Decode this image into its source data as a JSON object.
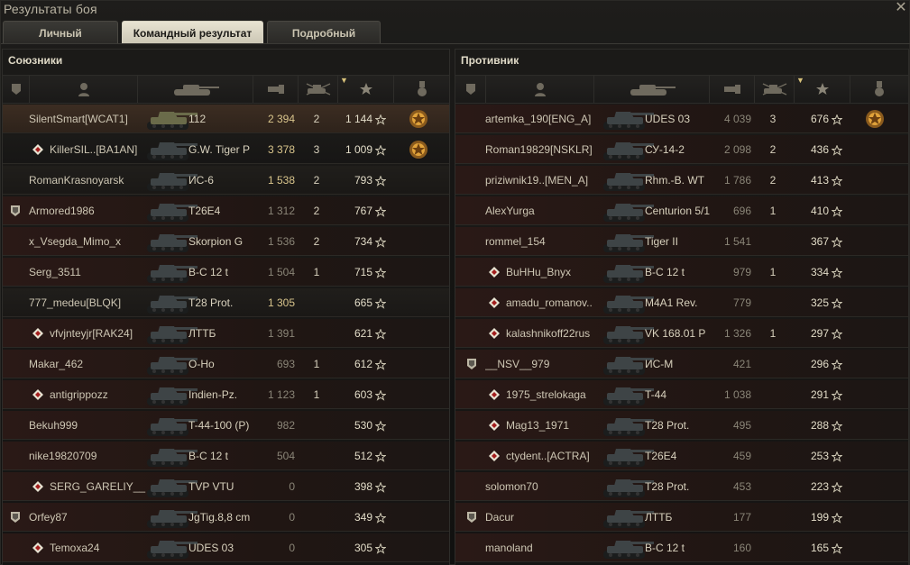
{
  "window": {
    "title": "Результаты боя",
    "close": "✕"
  },
  "tabs": [
    {
      "label": "Личный результат",
      "active": false
    },
    {
      "label": "Командный результат",
      "active": true
    },
    {
      "label": "Подробный отчёт",
      "active": false
    }
  ],
  "allies": {
    "title": "Союзники",
    "rows": [
      {
        "name": "SilentSmart[WCAT1]",
        "vehicle": "112",
        "damage": "2 394",
        "dmg_hi": true,
        "kills": "2",
        "xp": "1 144",
        "medal": true,
        "self": true,
        "badge": ""
      },
      {
        "name": "KillerSIL..[BA1AN]",
        "vehicle": "G.W. Tiger P",
        "damage": "3 378",
        "dmg_hi": true,
        "kills": "3",
        "xp": "1 009",
        "medal": true,
        "badge": "diamond"
      },
      {
        "name": "RomanKrasnoyarsk",
        "vehicle": "ИС-6",
        "damage": "1 538",
        "dmg_hi": true,
        "kills": "2",
        "xp": "793",
        "badge": ""
      },
      {
        "name": "Armored1986",
        "vehicle": "T26E4",
        "damage": "1 312",
        "dmg_hi": false,
        "kills": "2",
        "xp": "767",
        "badge": "platoon",
        "red": true
      },
      {
        "name": "x_Vsegda_Mimo_x",
        "vehicle": "Skorpion G",
        "damage": "1 536",
        "dmg_hi": false,
        "kills": "2",
        "xp": "734",
        "badge": "",
        "red": true
      },
      {
        "name": "Serg_3511",
        "vehicle": "В-С 12 t",
        "damage": "1 504",
        "dmg_hi": false,
        "kills": "1",
        "xp": "715",
        "badge": "",
        "red": true
      },
      {
        "name": "777_medeu[BLQK]",
        "vehicle": "T28 Prot.",
        "damage": "1 305",
        "dmg_hi": true,
        "kills": "",
        "xp": "665",
        "badge": ""
      },
      {
        "name": "vfvjnteyjr[RAK24]",
        "vehicle": "ЛТТБ",
        "damage": "1 391",
        "dmg_hi": false,
        "kills": "",
        "xp": "621",
        "badge": "diamond",
        "red": true
      },
      {
        "name": "Makar_462",
        "vehicle": "O-Ho",
        "damage": "693",
        "dmg_hi": false,
        "kills": "1",
        "xp": "612",
        "badge": "",
        "red": true
      },
      {
        "name": "antigrippozz",
        "vehicle": "Indien-Pz.",
        "damage": "1 123",
        "dmg_hi": false,
        "kills": "1",
        "xp": "603",
        "badge": "diamond",
        "red": true
      },
      {
        "name": "Bekuh999",
        "vehicle": "T-44-100 (P)",
        "damage": "982",
        "dmg_hi": false,
        "kills": "",
        "xp": "530",
        "badge": "",
        "red": true
      },
      {
        "name": "nike19820709",
        "vehicle": "В-С 12 t",
        "damage": "504",
        "dmg_hi": false,
        "kills": "",
        "xp": "512",
        "badge": "",
        "red": true
      },
      {
        "name": "SERG_GARELIY__",
        "vehicle": "TVP VTU",
        "damage": "0",
        "dmg_hi": false,
        "kills": "",
        "xp": "398",
        "badge": "diamond",
        "red": true
      },
      {
        "name": "Orfey87",
        "vehicle": "JgTig.8,8 cm",
        "damage": "0",
        "dmg_hi": false,
        "kills": "",
        "xp": "349",
        "badge": "platoon",
        "red": true
      },
      {
        "name": "Temoxa24",
        "vehicle": "UDES 03",
        "damage": "0",
        "dmg_hi": false,
        "kills": "",
        "xp": "305",
        "badge": "diamond",
        "red": true
      }
    ]
  },
  "enemies": {
    "title": "Противник",
    "rows": [
      {
        "name": "artemka_190[ENG_A]",
        "vehicle": "UDES 03",
        "damage": "4 039",
        "kills": "3",
        "xp": "676",
        "medal": true,
        "badge": "",
        "red": true
      },
      {
        "name": "Roman19829[NSKLR]",
        "vehicle": "СУ-14-2",
        "damage": "2 098",
        "kills": "2",
        "xp": "436",
        "badge": "",
        "red": true
      },
      {
        "name": "priziwnik19..[MEN_A]",
        "vehicle": "Rhm.-B. WT",
        "damage": "1 786",
        "kills": "2",
        "xp": "413",
        "badge": "",
        "red": true
      },
      {
        "name": "AlexYurga",
        "vehicle": "Centurion 5/1",
        "damage": "696",
        "kills": "1",
        "xp": "410",
        "badge": "",
        "red": true
      },
      {
        "name": "rommel_154",
        "vehicle": "Tiger II",
        "damage": "1 541",
        "kills": "",
        "xp": "367",
        "badge": "",
        "red": true
      },
      {
        "name": "BuHHu_Bnyx",
        "vehicle": "В-С 12 t",
        "damage": "979",
        "kills": "1",
        "xp": "334",
        "badge": "diamond",
        "red": true
      },
      {
        "name": "amadu_romanov..",
        "vehicle": "M4A1 Rev.",
        "damage": "779",
        "kills": "",
        "xp": "325",
        "badge": "diamond",
        "red": true
      },
      {
        "name": "kalashnikoff22rus",
        "vehicle": "VK 168.01 P",
        "damage": "1 326",
        "kills": "1",
        "xp": "297",
        "badge": "diamond",
        "red": true
      },
      {
        "name": "__NSV__979",
        "vehicle": "ИС-М",
        "damage": "421",
        "kills": "",
        "xp": "296",
        "badge": "platoon",
        "red": true
      },
      {
        "name": "1975_strelokaga",
        "vehicle": "T-44",
        "damage": "1 038",
        "kills": "",
        "xp": "291",
        "badge": "diamond",
        "red": true
      },
      {
        "name": "Mag13_1971",
        "vehicle": "T28 Prot.",
        "damage": "495",
        "kills": "",
        "xp": "288",
        "badge": "diamond",
        "red": true
      },
      {
        "name": "ctydent..[ACTRA]",
        "vehicle": "T26E4",
        "damage": "459",
        "kills": "",
        "xp": "253",
        "badge": "diamond",
        "red": true
      },
      {
        "name": "solomon70",
        "vehicle": "T28 Prot.",
        "damage": "453",
        "kills": "",
        "xp": "223",
        "badge": "",
        "red": true
      },
      {
        "name": "Dacur",
        "vehicle": "ЛТТБ",
        "damage": "177",
        "kills": "",
        "xp": "199",
        "badge": "platoon",
        "red": true
      },
      {
        "name": "manoland",
        "vehicle": "В-С 12 t",
        "damage": "160",
        "kills": "",
        "xp": "165",
        "badge": "",
        "red": true
      }
    ]
  },
  "columns": {
    "icons": [
      "platoon-icon",
      "player-icon",
      "tank-icon",
      "damage-icon",
      "kills-icon",
      "xp-star-icon",
      "medal-icon"
    ],
    "sorted_column": "xp"
  },
  "colors": {
    "accent_gold": "#d9c58c",
    "active_tab": "#e8e3d2",
    "self_row": "#3c2d22"
  }
}
